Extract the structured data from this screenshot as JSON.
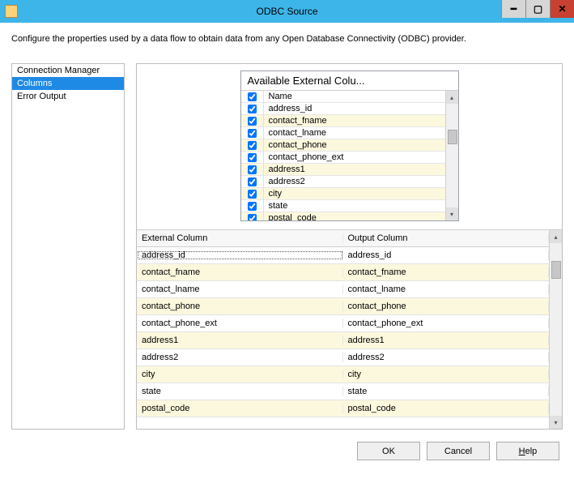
{
  "window": {
    "title": "ODBC Source"
  },
  "description": "Configure the properties used by a data flow to obtain data from any Open Database Connectivity (ODBC) provider.",
  "nav": {
    "items": [
      {
        "label": "Connection Manager",
        "selected": false
      },
      {
        "label": "Columns",
        "selected": true
      },
      {
        "label": "Error Output",
        "selected": false
      }
    ]
  },
  "available": {
    "title": "Available External Colu...",
    "headerLabel": "Name",
    "columns": [
      {
        "name": "address_id",
        "checked": true
      },
      {
        "name": "contact_fname",
        "checked": true
      },
      {
        "name": "contact_lname",
        "checked": true
      },
      {
        "name": "contact_phone",
        "checked": true
      },
      {
        "name": "contact_phone_ext",
        "checked": true
      },
      {
        "name": "address1",
        "checked": true
      },
      {
        "name": "address2",
        "checked": true
      },
      {
        "name": "city",
        "checked": true
      },
      {
        "name": "state",
        "checked": true
      },
      {
        "name": "postal_code",
        "checked": true
      }
    ]
  },
  "mapping": {
    "headers": {
      "external": "External Column",
      "output": "Output Column"
    },
    "rows": [
      {
        "external": "address_id",
        "output": "address_id"
      },
      {
        "external": "contact_fname",
        "output": "contact_fname"
      },
      {
        "external": "contact_lname",
        "output": "contact_lname"
      },
      {
        "external": "contact_phone",
        "output": "contact_phone"
      },
      {
        "external": "contact_phone_ext",
        "output": "contact_phone_ext"
      },
      {
        "external": "address1",
        "output": "address1"
      },
      {
        "external": "address2",
        "output": "address2"
      },
      {
        "external": "city",
        "output": "city"
      },
      {
        "external": "state",
        "output": "state"
      },
      {
        "external": "postal_code",
        "output": "postal_code"
      }
    ]
  },
  "buttons": {
    "ok": "OK",
    "cancel": "Cancel",
    "help": "Help"
  }
}
